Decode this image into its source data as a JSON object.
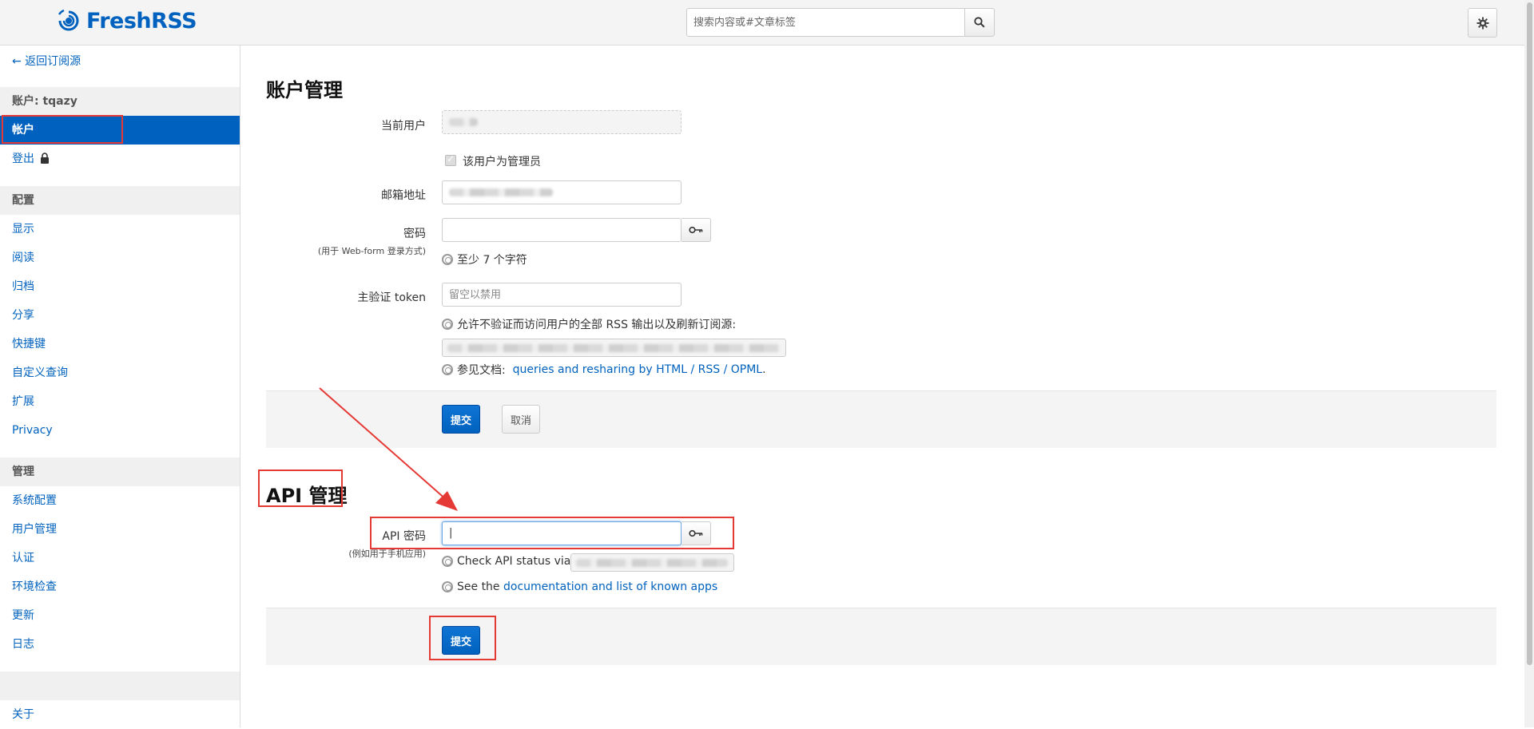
{
  "header": {
    "logo_text": "FreshRSS",
    "search_placeholder": "搜索内容或#文章标签"
  },
  "sidebar": {
    "back_link": "← 返回订阅源",
    "account_section": "账户: tqazy",
    "account_items": [
      "帐户",
      "登出"
    ],
    "config_section": "配置",
    "config_items": [
      "显示",
      "阅读",
      "归档",
      "分享",
      "快捷键",
      "自定义查询",
      "扩展",
      "Privacy"
    ],
    "admin_section": "管理",
    "admin_items": [
      "系统配置",
      "用户管理",
      "认证",
      "环境检查",
      "更新",
      "日志"
    ],
    "about": "关于"
  },
  "account": {
    "title": "账户管理",
    "current_user_label": "当前用户",
    "is_admin_label": "该用户为管理员",
    "email_label": "邮箱地址",
    "password_label": "密码",
    "password_sublabel": "(用于 Web-form 登录方式)",
    "password_help": "至少 7 个字符",
    "token_label": "主验证 token",
    "token_placeholder": "留空以禁用",
    "token_help": "允许不验证而访问用户的全部 RSS 输出以及刷新订阅源:",
    "docs_prefix": "参见文档:",
    "docs_link": "queries and resharing by HTML / RSS / OPML",
    "docs_suffix": ".",
    "submit": "提交",
    "cancel": "取消"
  },
  "api": {
    "title": "API 管理",
    "password_label": "API 密码",
    "password_sublabel": "(例如用于手机应用)",
    "password_value": "|",
    "status_help": "Check API status via:",
    "see_prefix": "See the",
    "see_link": "documentation and list of known apps",
    "submit": "提交"
  }
}
